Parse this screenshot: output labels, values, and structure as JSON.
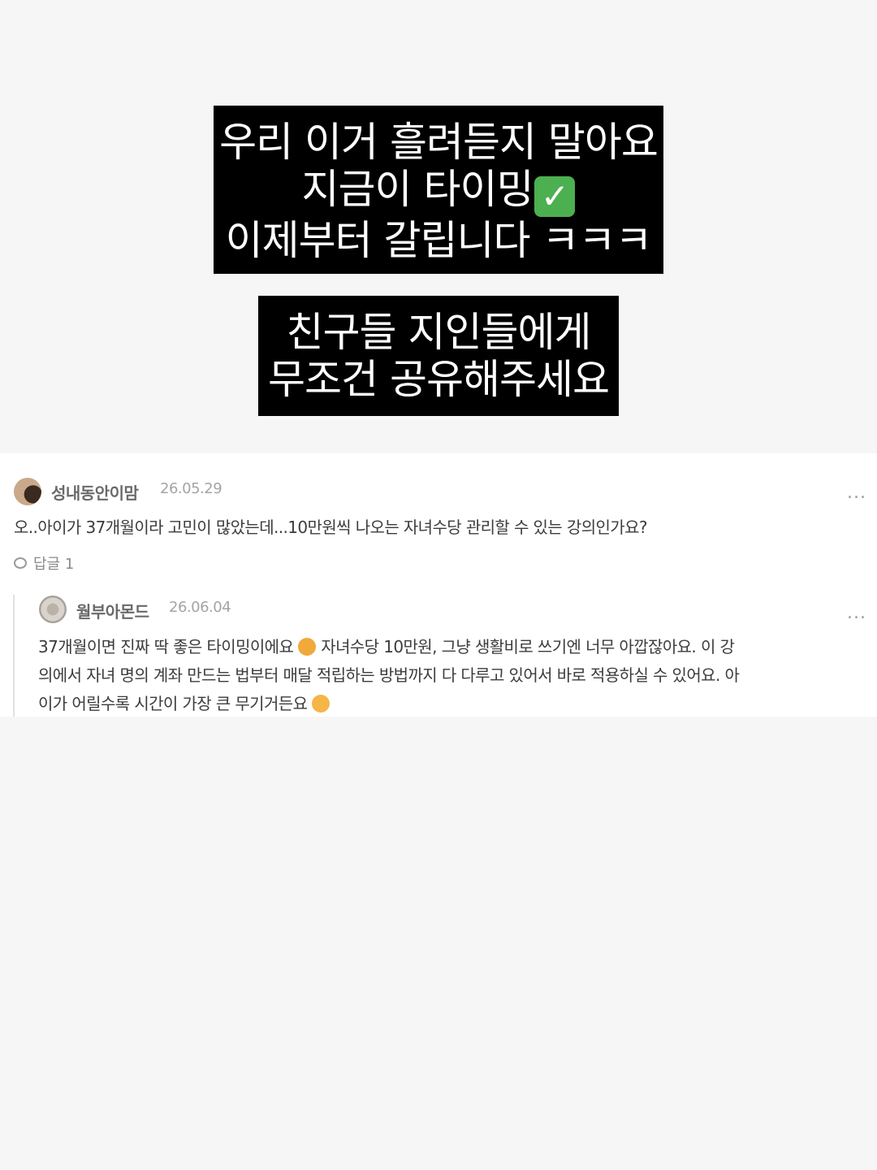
{
  "captions": {
    "box1": {
      "line1": "우리 이거 흘려듣지 말아요",
      "line2": "지금이 타이밍",
      "check_emoji": "✓",
      "line3": "이제부터 갈립니다 ㅋㅋㅋ"
    },
    "box2": {
      "line1": "친구들 지인들에게",
      "line2": "무조건 공유해주세요"
    }
  },
  "comments": {
    "main": {
      "author": "성내동안이맘",
      "date": "26.05.29",
      "more": "...",
      "text": "오..아이가 37개월이라 고민이 많았는데...10만원씩 나오는 자녀수당 관리할 수 있는 강의인가요?",
      "reply_label": "답글 1"
    },
    "reply": {
      "author": "월부아몬드",
      "date": "26.06.04",
      "more": "...",
      "text_line1a": "37개월이면 진짜 딱 좋은 타이밍이에요",
      "text_line1b": "자녀수당 10만원, 그냥 생활비로 쓰기엔 너무 아깝잖아요. 이 강",
      "text_line2": "의에서 자녀 명의 계좌 만드는 법부터 매달 적립하는 방법까지 다 다루고 있어서 바로 적용하실 수 있어요. 아",
      "text_line3": "이가 어릴수록 시간이 가장 큰 무기거든요"
    }
  }
}
